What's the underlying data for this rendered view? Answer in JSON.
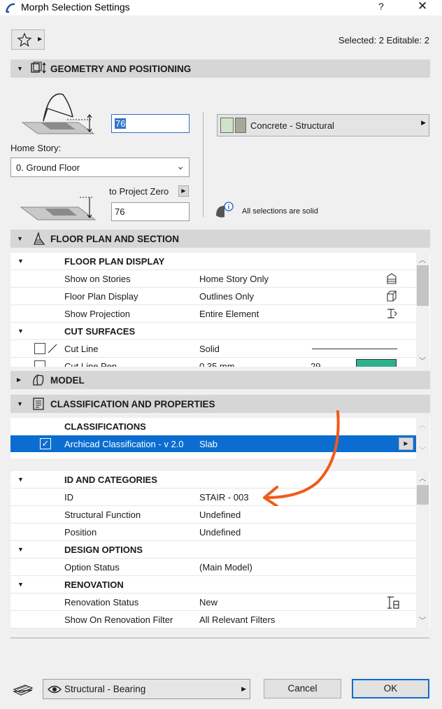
{
  "window": {
    "title": "Morph Selection Settings",
    "help_label": "?",
    "close_label": "✕"
  },
  "selection_info": "Selected: 2 Editable: 2",
  "geometry": {
    "header": "GEOMETRY AND POSITIONING",
    "height_value": "76",
    "home_story_label": "Home Story:",
    "home_story_value": "0. Ground Floor",
    "to_project_zero_label": "to Project Zero",
    "elevation_value": "76",
    "material_label": "Concrete - Structural",
    "solid_note": "All selections are solid"
  },
  "floor_plan": {
    "header": "FLOOR PLAN AND SECTION",
    "group1": "FLOOR PLAN DISPLAY",
    "rows": [
      {
        "label": "Show on Stories",
        "value": "Home Story Only"
      },
      {
        "label": "Floor Plan Display",
        "value": "Outlines Only"
      },
      {
        "label": "Show Projection",
        "value": "Entire Element"
      }
    ],
    "group2": "CUT SURFACES",
    "cut_line_label": "Cut Line",
    "cut_line_value": "Solid",
    "cut_pen_label": "Cut Line Pen",
    "cut_pen_value": "0.35 mm",
    "cut_pen_number": "29"
  },
  "model": {
    "header": "MODEL"
  },
  "classification": {
    "header": "CLASSIFICATION AND PROPERTIES",
    "group": "CLASSIFICATIONS",
    "row_label": "Archicad Classification - v 2.0",
    "row_value": "Slab"
  },
  "properties": {
    "group_id": "ID AND CATEGORIES",
    "id_rows": [
      {
        "label": "ID",
        "value": "STAIR - 003"
      },
      {
        "label": "Structural Function",
        "value": "Undefined"
      },
      {
        "label": "Position",
        "value": "Undefined"
      }
    ],
    "group_design": "DESIGN OPTIONS",
    "design_rows": [
      {
        "label": "Option Status",
        "value": "(Main Model)"
      }
    ],
    "group_renovation": "RENOVATION",
    "renovation_rows": [
      {
        "label": "Renovation Status",
        "value": "New"
      },
      {
        "label": "Show On Renovation Filter",
        "value": "All Relevant Filters"
      }
    ]
  },
  "footer": {
    "layer_value": "Structural - Bearing",
    "cancel_label": "Cancel",
    "ok_label": "OK"
  },
  "colors": {
    "accent": "#0b6dd0",
    "annotation_arrow": "#f05a1a",
    "section_bar": "#d6d6d6"
  }
}
